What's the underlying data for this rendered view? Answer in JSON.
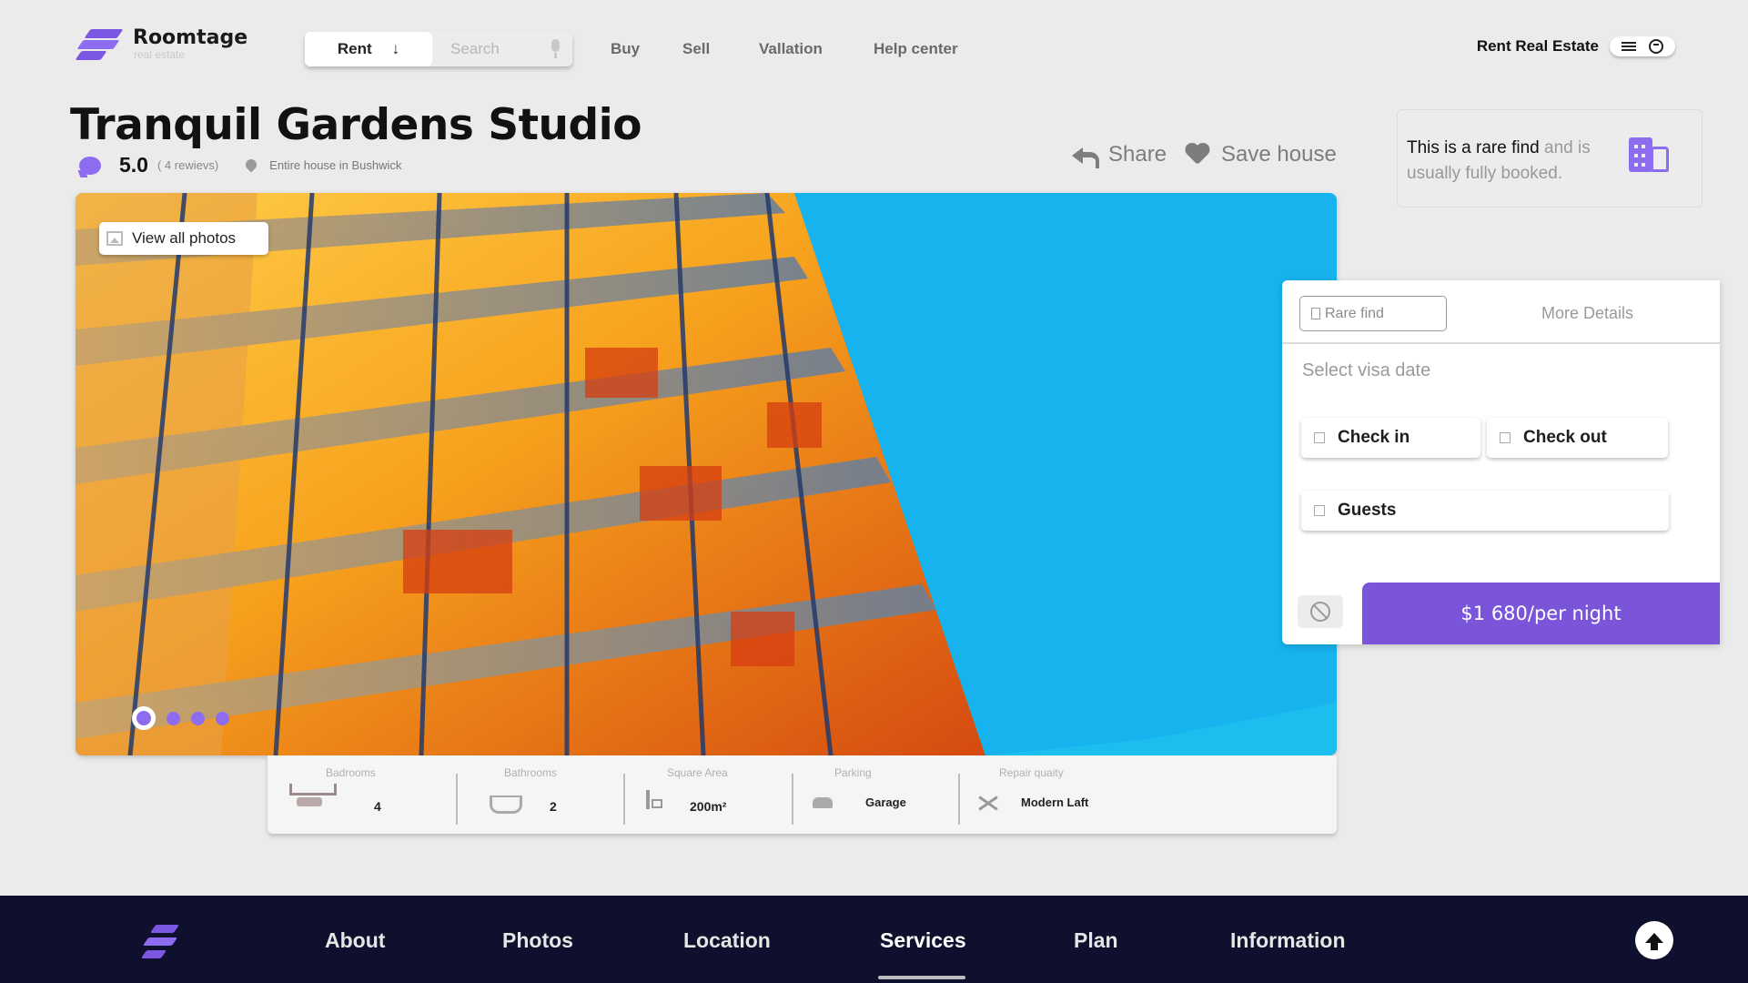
{
  "brand": {
    "name": "Roomtage",
    "tagline": "real estate"
  },
  "search": {
    "mode_label": "Rent",
    "placeholder": "Search"
  },
  "top_nav": [
    "Buy",
    "Sell",
    "Vallation",
    "Help center"
  ],
  "account": {
    "title": "Rent Real Estate"
  },
  "listing": {
    "title": "Tranquil Gardens Studio",
    "rating": "5.0",
    "reviews": "( 4 rewievs)",
    "location": "Entire house in Bushwick",
    "share_label": "Share",
    "save_label": "Save house"
  },
  "rare_card": {
    "strong": "This is a rare find",
    "rest": " and is usually fully booked."
  },
  "gallery": {
    "view_all_label": "View all photos",
    "photo_count": 4,
    "active_photo": 1
  },
  "specs": [
    {
      "label": "Badrooms",
      "value": "4",
      "icon": "bed-icon"
    },
    {
      "label": "Bathrooms",
      "value": "2",
      "icon": "bathtub-icon"
    },
    {
      "label": "Square Area",
      "value": "200m²",
      "icon": "floorplan-icon"
    },
    {
      "label": "Parking",
      "value": "Garage",
      "icon": "car-icon"
    },
    {
      "label": "Repair quaity",
      "value": "Modern Laft",
      "icon": "tools-icon"
    }
  ],
  "booking": {
    "tab_rare": "Rare find",
    "tab_more": "More Details",
    "visa_label": "Select visa date",
    "check_in": "Check in",
    "check_out": "Check out",
    "guests": "Guests",
    "price": "$1 680/per night"
  },
  "footer_nav": {
    "items": [
      "About",
      "Photos",
      "Location",
      "Services",
      "Plan",
      "Information"
    ],
    "active": "Services"
  },
  "colors": {
    "accent": "#7a55da",
    "footer_bg": "#0f0f2e",
    "page_bg": "#ebebeb"
  }
}
